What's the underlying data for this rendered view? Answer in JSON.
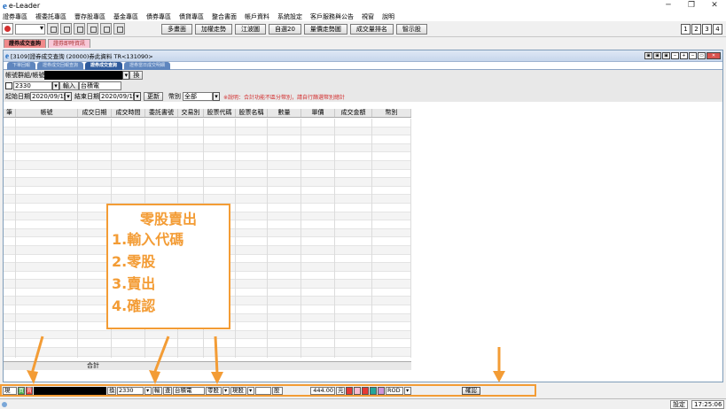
{
  "app": {
    "title": "e-Leader"
  },
  "menu": [
    "證券專區",
    "複委託專區",
    "豐存股專區",
    "基金專區",
    "債券專區",
    "債貸專區",
    "整合書面",
    "帳戶資料",
    "系統設定",
    "客戶服務與公告",
    "視窗",
    "說明"
  ],
  "toolbar": {
    "buttons": [
      "多畫面",
      "加權走勢",
      "江波圖",
      "自選20",
      "量價走勢圖",
      "成交量排名",
      "智示股"
    ],
    "windows": [
      "1",
      "2",
      "3",
      "4"
    ]
  },
  "tabs": [
    {
      "label": "證券成交查詢",
      "active": true
    },
    {
      "label": "證券即時資訊",
      "active": false
    }
  ],
  "subwindow": {
    "title": "[3109]證券成交查詢 (20000)券此資料 TR<131090>",
    "tabs": [
      "下單回報",
      "證券成交回報查詢",
      "證券成交查詢",
      "證券當日成交明細"
    ],
    "account_label": "帳號群組/帳號",
    "account_switch": "換",
    "stock_code": "2330",
    "input_btn": "輸入",
    "stock_name": "台積電",
    "start_label": "起始日期",
    "start_date": "2020/09/19",
    "end_label": "結束日期",
    "end_date": "2020/09/19",
    "update_btn": "更新",
    "currency_label": "幣別",
    "currency_value": "全部",
    "note": "※說明：合計功能不區分幣別，請自行篩選幣別總計"
  },
  "grid": {
    "columns": [
      "筆",
      "帳號",
      "成交日期",
      "成交時間",
      "委託書號",
      "交易別",
      "股票代碼",
      "股票名稱",
      "數量",
      "單價",
      "成交金額",
      "幣別"
    ],
    "total_label": "合計"
  },
  "callout": {
    "title": "零股賣出",
    "steps": [
      "1.輸入代碼",
      "2.零股",
      "3.賣出",
      "4.確認"
    ]
  },
  "order_bar": {
    "type": "現",
    "buy": "買",
    "sell": "賣",
    "switch": "換",
    "stock_code": "2330",
    "input_btn": "輸",
    "query_btn": "查",
    "stock_name": "台積電",
    "lot_type": "零股",
    "price_type": "現股",
    "qty_unit": "股",
    "price": "444.00",
    "price_flag": "元",
    "condition": "ROD",
    "confirm": "確認"
  },
  "status": {
    "settings": "設定",
    "time": "17:25:06"
  }
}
